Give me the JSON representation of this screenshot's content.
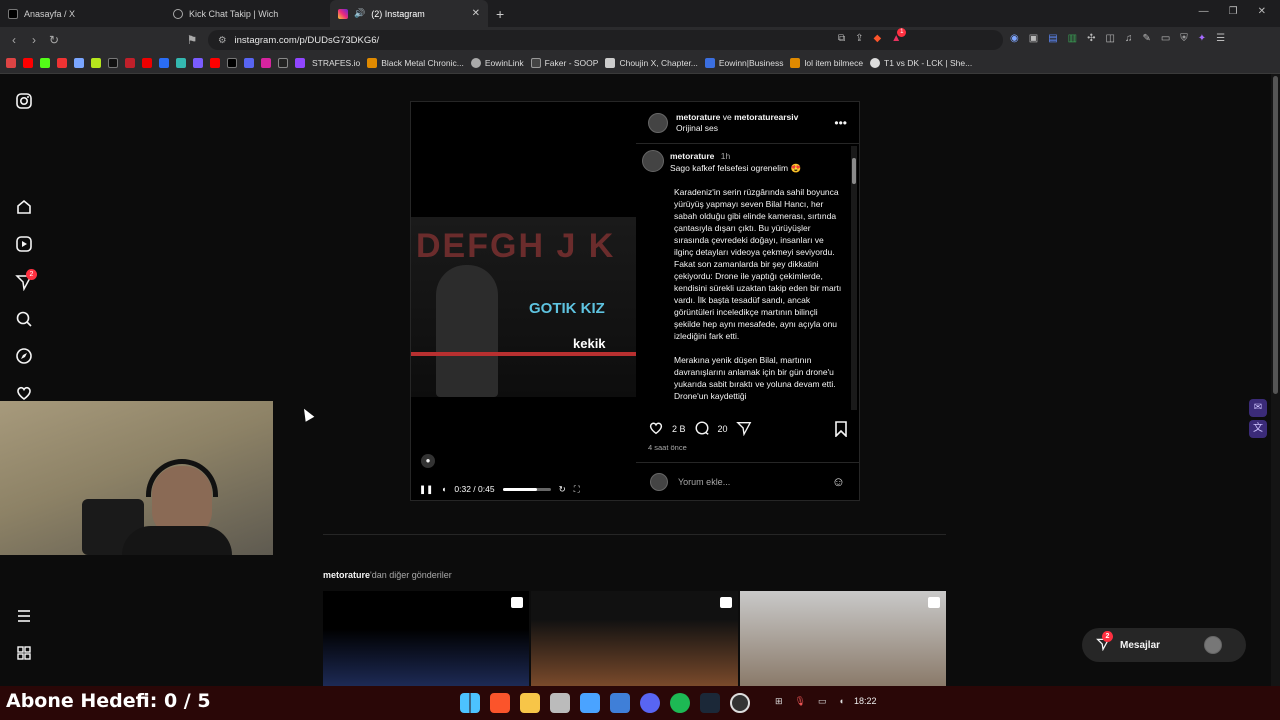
{
  "browser": {
    "tabs": [
      {
        "title": "Anasayfa / X",
        "active": false
      },
      {
        "title": "Kick Chat Takip | Wich",
        "active": false
      },
      {
        "title": "(2) Instagram",
        "active": true
      }
    ],
    "new_tab_label": "+",
    "url": "instagram.com/p/DUDsG73DKG6/",
    "brave_badge": "1",
    "bookmarks": [
      "STRAFES.io",
      "Black Metal Chronic...",
      "EowinLink",
      "Faker - SOOP",
      "Choujin X, Chapter...",
      "Eowinn|Business",
      "lol item bilmece",
      "T1 vs DK - LCK | She..."
    ]
  },
  "sidebar": {
    "notification_badge": "2"
  },
  "post": {
    "header_user": "metorature",
    "header_connector": " ve ",
    "header_user2": "metoraturearsiv",
    "audio": "Orijinal ses",
    "video": {
      "letters": "DEFGH J K",
      "title": "GOTIK KIZ",
      "subtitle": "kekik",
      "time": "0:32 / 0:45",
      "progress_fraction": 0.71
    },
    "caption_user": "metorature",
    "caption_time": "1h",
    "caption_line": "Sago kafkef felsefesi ogrenelim 😍",
    "caption_p1": "Karadeniz'in serin rüzgârında sahil boyunca yürüyüş yapmayı seven Bilal Hancı, her sabah olduğu gibi elinde kamerası, sırtında çantasıyla dışarı çıktı. Bu yürüyüşler sırasında çevredeki doğayı, insanları ve ilginç detayları videoya çekmeyi seviyordu. Fakat son zamanlarda bir şey dikkatini çekiyordu: Drone ile yaptığı çekimlerde, kendisini sürekli uzaktan takip eden bir martı vardı. İlk başta tesadüf sandı, ancak görüntüleri inceledikçe martının bilinçli şekilde hep aynı mesafede, aynı açıyla onu izlediğini fark etti.",
    "caption_p2": "Merakına yenik düşen Bilal, martının davranışlarını anlamak için bir gün drone'u yukarıda sabit bıraktı ve yoluna devam etti. Drone'un kaydettiği",
    "likes": "2 B",
    "comments": "20",
    "ago": "4 saat önce",
    "comment_placeholder": "Yorum ekle..."
  },
  "more_posts": {
    "user": "metorature",
    "suffix": "'dan diğer gönderiler"
  },
  "messages": {
    "label": "Mesajlar",
    "badge": "2"
  },
  "stream": {
    "goal_text": "Abone Hedefi:  0 / 5"
  },
  "taskbar": {
    "clock": "18:22"
  }
}
